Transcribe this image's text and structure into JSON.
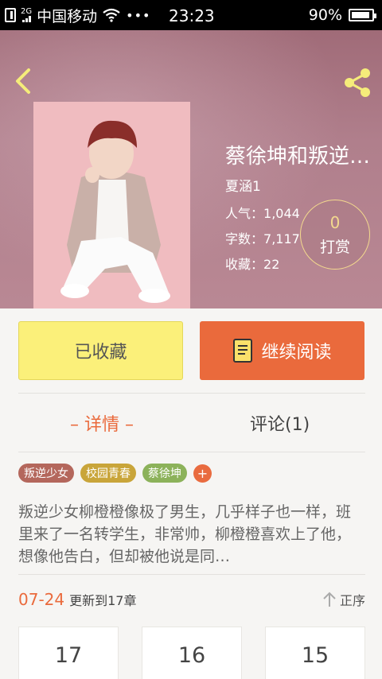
{
  "status_bar": {
    "network": "2G",
    "carrier": "中国移动",
    "dots": "•••",
    "time": "23:23",
    "battery": "90%",
    "battery_level": 0.9
  },
  "book": {
    "title": "蔡徐坤和叛逆…",
    "author": "夏涵1",
    "popularity_label": "人气：",
    "popularity_value": "1,044",
    "words_label": "字数：",
    "words_value": "7,117",
    "favorites_label": "收藏：",
    "favorites_value": "22"
  },
  "tip": {
    "count": "0",
    "label": "打赏"
  },
  "actions": {
    "collected_label": "已收藏",
    "continue_label": "继续阅读"
  },
  "tabs": {
    "details": "– 详情 –",
    "comments": "评论(1)"
  },
  "tags": [
    {
      "label": "叛逆少女",
      "color": "#b4675c"
    },
    {
      "label": "校园青春",
      "color": "#c9a53a"
    },
    {
      "label": "蔡徐坤",
      "color": "#8cb25a"
    }
  ],
  "tag_add_symbol": "+",
  "description": "叛逆少女柳橙橙像极了男生，几乎样子也一样，班里来了一名转学生，非常帅，柳橙橙喜欢上了他，想像他告白，但却被他说是同…",
  "update": {
    "date": "07-24",
    "text": "更新到17章",
    "sort_label": "正序"
  },
  "chapters": [
    "17",
    "16",
    "15"
  ],
  "colors": {
    "accent": "#ea6a3c",
    "collected_bg": "#fbf07a",
    "tip_ring": "#f3d98e"
  }
}
